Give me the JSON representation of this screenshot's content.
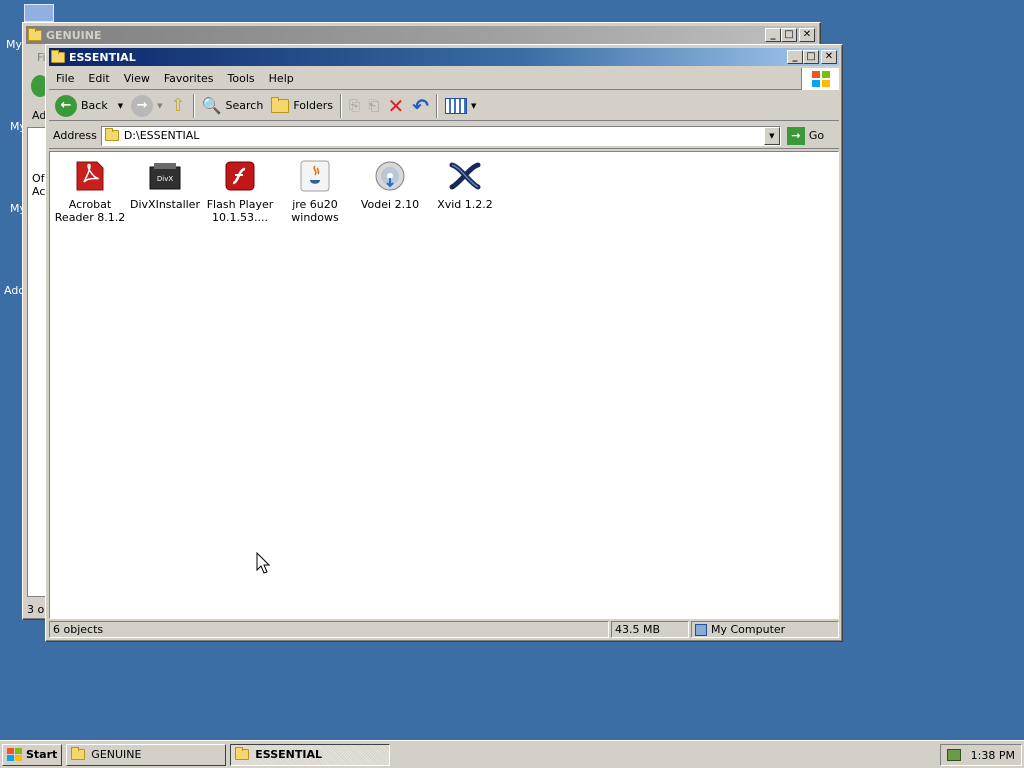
{
  "desktop": {
    "labels": [
      "My",
      "My",
      "My",
      "Add"
    ]
  },
  "back_window": {
    "title": "GENUINE",
    "peek_text_1": "Fi",
    "peek_text_2": "Ad",
    "peek_text_3": "Of",
    "peek_text_4": "Ac",
    "status_peek": "3 ol"
  },
  "window": {
    "title": "ESSENTIAL",
    "menu": [
      "File",
      "Edit",
      "View",
      "Favorites",
      "Tools",
      "Help"
    ],
    "toolbar": {
      "back_label": "Back",
      "search_label": "Search",
      "folders_label": "Folders"
    },
    "address": {
      "label": "Address",
      "value": "D:\\ESSENTIAL",
      "go_label": "Go"
    },
    "files": [
      {
        "name": "Acrobat Reader 8.1.2",
        "icon": "acrobat-icon"
      },
      {
        "name": "DivXInstaller",
        "icon": "divx-icon"
      },
      {
        "name": "Flash Player 10.1.53....",
        "icon": "flash-icon"
      },
      {
        "name": "jre 6u20 windows",
        "icon": "java-icon"
      },
      {
        "name": "Vodei 2.10",
        "icon": "vodei-icon"
      },
      {
        "name": "Xvid 1.2.2",
        "icon": "xvid-icon"
      }
    ],
    "status": {
      "objects": "6 objects",
      "size": "43.5 MB",
      "location": "My Computer"
    }
  },
  "taskbar": {
    "start_label": "Start",
    "tasks": [
      "GENUINE",
      "ESSENTIAL"
    ],
    "clock": "1:38 PM"
  },
  "colors": {
    "desktop": "#3a6ea5",
    "title_active": "#0a246a"
  }
}
